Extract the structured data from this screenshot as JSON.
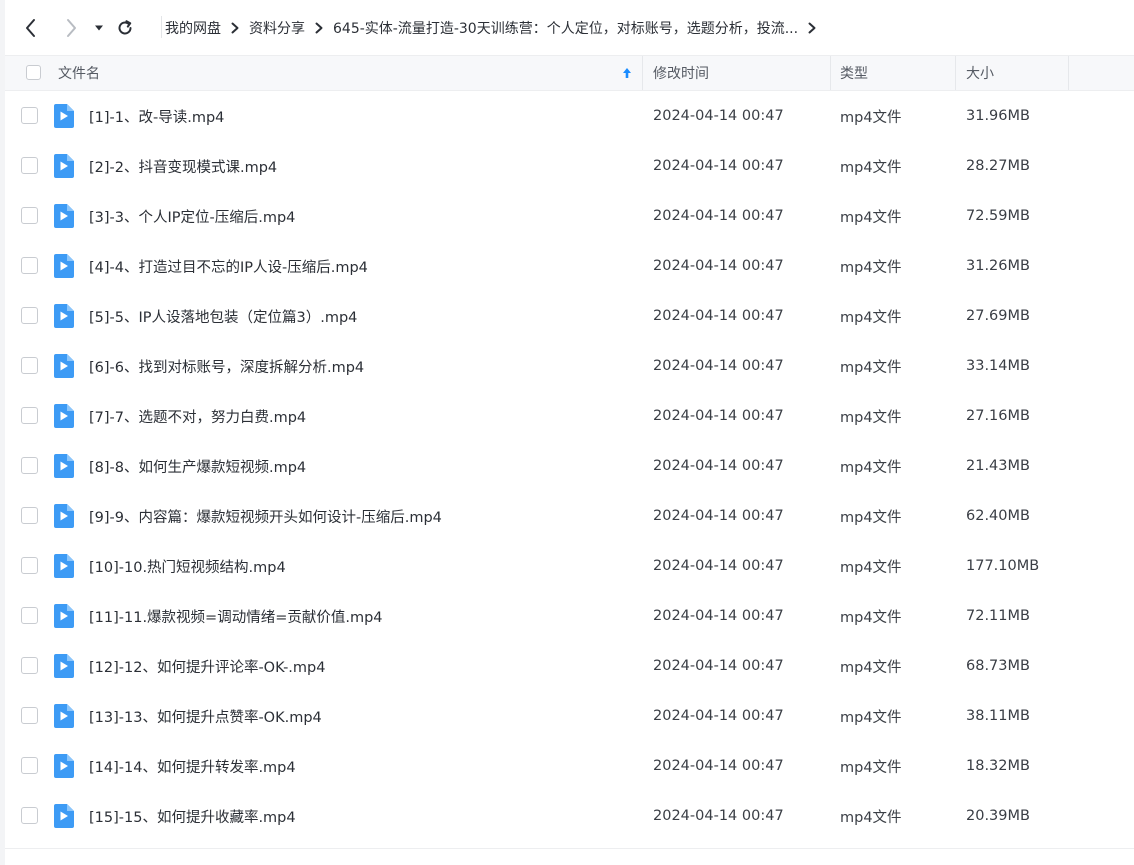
{
  "toolbar": {
    "back_icon": "chevron-left-icon",
    "forward_icon": "chevron-right-icon",
    "history_icon": "caret-down-icon",
    "refresh_icon": "refresh-icon"
  },
  "breadcrumb": {
    "items": [
      "我的网盘",
      "资料分享",
      "645-实体-流量打造-30天训练营：个人定位，对标账号，选题分析，投流..."
    ],
    "separator_icon": "chevron-right-icon"
  },
  "table": {
    "columns": {
      "name": "文件名",
      "modified": "修改时间",
      "type": "类型",
      "size": "大小"
    },
    "sort_icon": "arrow-up-icon",
    "rows": [
      {
        "name": "[1]-1、改-导读.mp4",
        "modified": "2024-04-14 00:47",
        "type": "mp4文件",
        "size": "31.96MB"
      },
      {
        "name": "[2]-2、抖音变现模式课.mp4",
        "modified": "2024-04-14 00:47",
        "type": "mp4文件",
        "size": "28.27MB"
      },
      {
        "name": "[3]-3、个人IP定位-压缩后.mp4",
        "modified": "2024-04-14 00:47",
        "type": "mp4文件",
        "size": "72.59MB"
      },
      {
        "name": "[4]-4、打造过目不忘的IP人设-压缩后.mp4",
        "modified": "2024-04-14 00:47",
        "type": "mp4文件",
        "size": "31.26MB"
      },
      {
        "name": "[5]-5、IP人设落地包装（定位篇3）.mp4",
        "modified": "2024-04-14 00:47",
        "type": "mp4文件",
        "size": "27.69MB"
      },
      {
        "name": "[6]-6、找到对标账号，深度拆解分析.mp4",
        "modified": "2024-04-14 00:47",
        "type": "mp4文件",
        "size": "33.14MB"
      },
      {
        "name": "[7]-7、选题不对，努力白费.mp4",
        "modified": "2024-04-14 00:47",
        "type": "mp4文件",
        "size": "27.16MB"
      },
      {
        "name": "[8]-8、如何生产爆款短视频.mp4",
        "modified": "2024-04-14 00:47",
        "type": "mp4文件",
        "size": "21.43MB"
      },
      {
        "name": "[9]-9、内容篇：爆款短视频开头如何设计-压缩后.mp4",
        "modified": "2024-04-14 00:47",
        "type": "mp4文件",
        "size": "62.40MB"
      },
      {
        "name": "[10]-10.热门短视频结构.mp4",
        "modified": "2024-04-14 00:47",
        "type": "mp4文件",
        "size": "177.10MB"
      },
      {
        "name": "[11]-11.爆款视频=调动情绪=贡献价值.mp4",
        "modified": "2024-04-14 00:47",
        "type": "mp4文件",
        "size": "72.11MB"
      },
      {
        "name": "[12]-12、如何提升评论率-OK-.mp4",
        "modified": "2024-04-14 00:47",
        "type": "mp4文件",
        "size": "68.73MB"
      },
      {
        "name": "[13]-13、如何提升点赞率-OK.mp4",
        "modified": "2024-04-14 00:47",
        "type": "mp4文件",
        "size": "38.11MB"
      },
      {
        "name": "[14]-14、如何提升转发率.mp4",
        "modified": "2024-04-14 00:47",
        "type": "mp4文件",
        "size": "18.32MB"
      },
      {
        "name": "[15]-15、如何提升收藏率.mp4",
        "modified": "2024-04-14 00:47",
        "type": "mp4文件",
        "size": "20.39MB"
      }
    ],
    "file_icon": "video-file-icon"
  },
  "colors": {
    "accent": "#1a8cff",
    "file_icon": "#3d9bf5",
    "header_bg": "#f7f8fa"
  }
}
